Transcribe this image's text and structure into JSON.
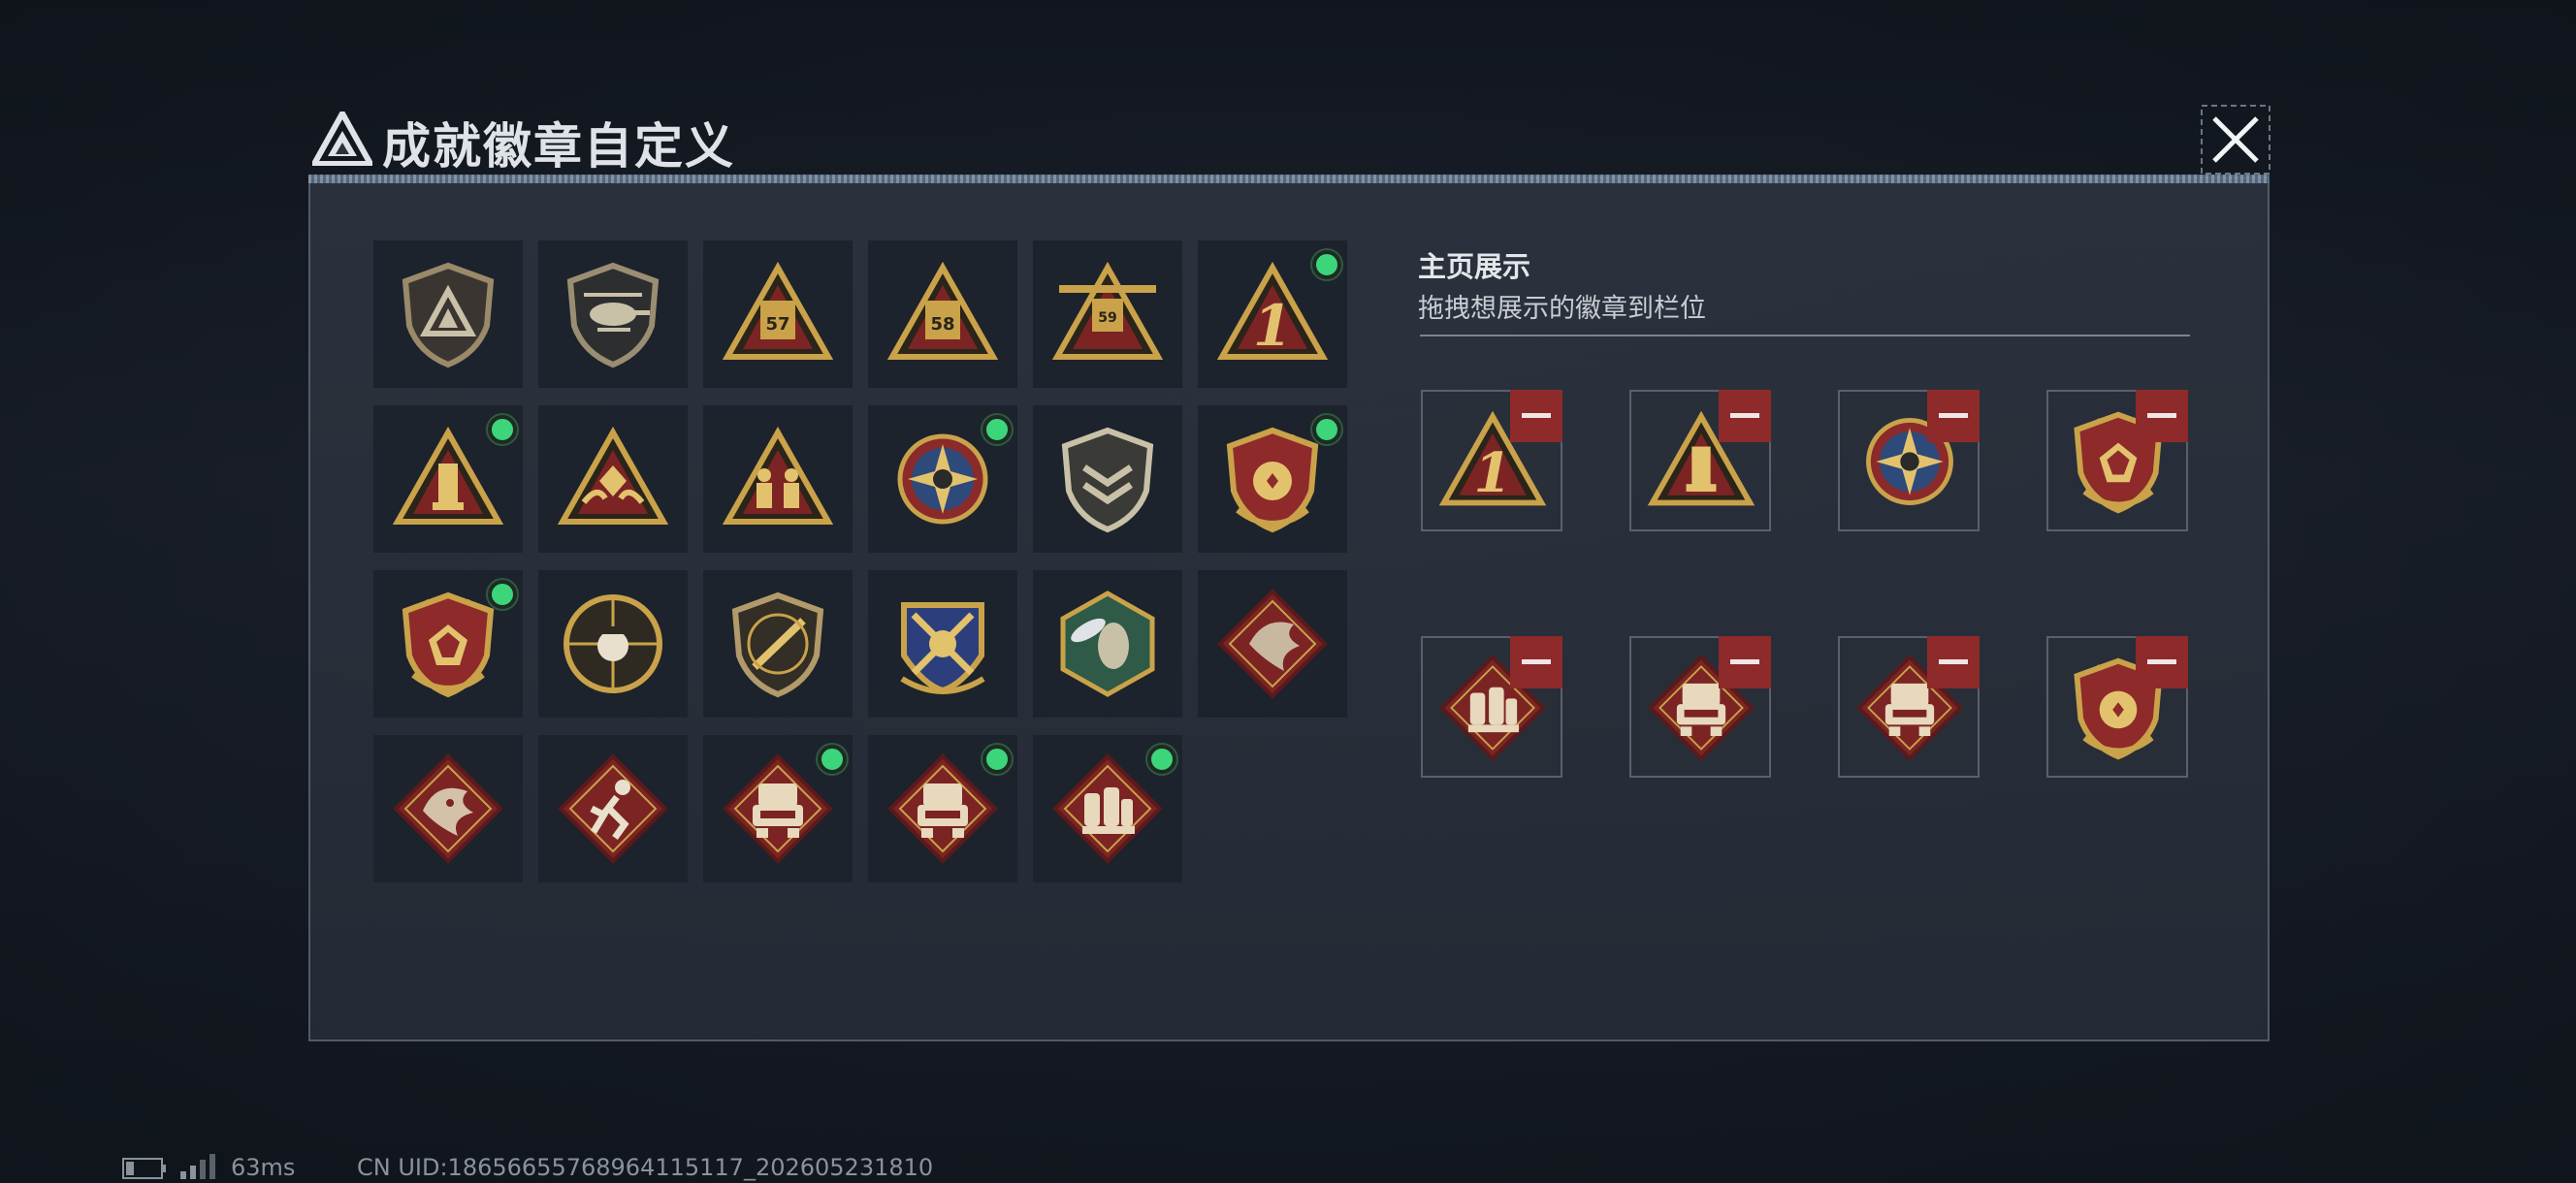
{
  "header": {
    "title": "成就徽章自定义",
    "close_icon": "close-icon"
  },
  "colors": {
    "new_dot": "#3dd57a",
    "remove_button": "#8e2a2a",
    "gold": "#c9a24a",
    "crimson": "#7c2424"
  },
  "badges": [
    {
      "icon": "shield-logo-badge",
      "new": false
    },
    {
      "icon": "helicopter-shield-badge",
      "new": false
    },
    {
      "icon": "triangle-57-badge",
      "new": false
    },
    {
      "icon": "triangle-58-badge",
      "new": false
    },
    {
      "icon": "triangle-59-winged-badge",
      "new": false
    },
    {
      "icon": "triangle-number-one-badge",
      "new": true
    },
    {
      "icon": "triangle-tower-badge",
      "new": true
    },
    {
      "icon": "triangle-hands-gem-badge",
      "new": false
    },
    {
      "icon": "triangle-soldiers-badge",
      "new": false
    },
    {
      "icon": "star-compass-medal-badge",
      "new": true
    },
    {
      "icon": "chevron-shield-badge",
      "new": false
    },
    {
      "icon": "crested-shield-wreath-badge",
      "new": true
    },
    {
      "icon": "crested-gem-shield-badge",
      "new": true
    },
    {
      "icon": "skull-crosshair-badge",
      "new": false
    },
    {
      "icon": "rifle-shield-badge",
      "new": false
    },
    {
      "icon": "crossed-weapons-crest-badge",
      "new": false
    },
    {
      "icon": "green-hex-wasp-badge",
      "new": false
    },
    {
      "icon": "dragon-diamond-badge",
      "new": false
    },
    {
      "icon": "dragon-head-diamond-badge",
      "new": false
    },
    {
      "icon": "runner-diamond-badge",
      "new": false
    },
    {
      "icon": "vehicle-diamond-badge",
      "new": true
    },
    {
      "icon": "vehicle-diamond-badge-2",
      "new": true
    },
    {
      "icon": "supplies-diamond-badge",
      "new": true
    }
  ],
  "display": {
    "title": "主页展示",
    "subtitle": "拖拽想展示的徽章到栏位",
    "slots": [
      {
        "icon": "triangle-number-one-badge"
      },
      {
        "icon": "triangle-tower-badge"
      },
      {
        "icon": "star-compass-medal-badge"
      },
      {
        "icon": "crested-gem-shield-badge"
      },
      {
        "icon": "supplies-diamond-badge"
      },
      {
        "icon": "vehicle-diamond-badge"
      },
      {
        "icon": "vehicle-diamond-badge-2"
      },
      {
        "icon": "crested-shield-wreath-badge"
      }
    ]
  },
  "footer": {
    "ping": "63ms",
    "uid": "CN UID:18656655768964115117_202605231810"
  }
}
